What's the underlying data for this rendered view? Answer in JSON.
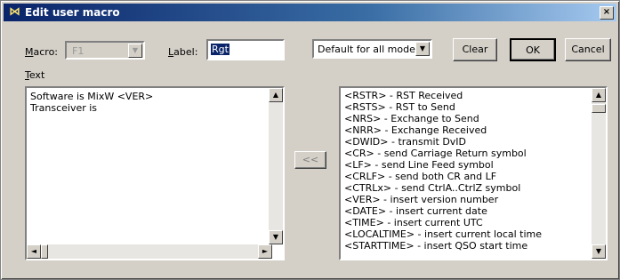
{
  "window": {
    "title": "Edit user macro",
    "close_label": "×"
  },
  "form": {
    "macro_label_prefix": "",
    "macro_label_u": "M",
    "macro_label_rest": "acro:",
    "macro_value": "F1",
    "label_label_u": "L",
    "label_label_rest": "abel:",
    "label_value": "Rgt",
    "text_label_u": "T",
    "text_label_rest": "ext",
    "mode_value": "Default for all modes"
  },
  "buttons": {
    "clear": "Clear",
    "ok": "OK",
    "cancel": "Cancel",
    "insert": "<<"
  },
  "text_area": {
    "lines": [
      "Software is MixW <VER>",
      "Transceiver is"
    ]
  },
  "macro_list": {
    "items": [
      "<RSTR> - RST Received",
      "<RSTS> - RST to Send",
      "<NRS> - Exchange to Send",
      "<NRR> - Exchange Received",
      "<DWID> - transmit DvID",
      "<CR> - send Carriage Return symbol",
      "<LF> - send Line Feed symbol",
      "<CRLF> - send both CR and LF",
      "<CTRLx> - send CtrlA..CtrlZ symbol",
      "<VER> - insert version number",
      "<DATE> - insert current date",
      "<TIME> - insert current UTC",
      "<LOCALTIME> - insert current local time",
      "<STARTTIME> - insert QSO start time"
    ]
  },
  "icons": {
    "app": "mixw-logo-icon",
    "dropdown": "▼",
    "up": "▲",
    "down": "▼",
    "left": "◄",
    "right": "►"
  }
}
